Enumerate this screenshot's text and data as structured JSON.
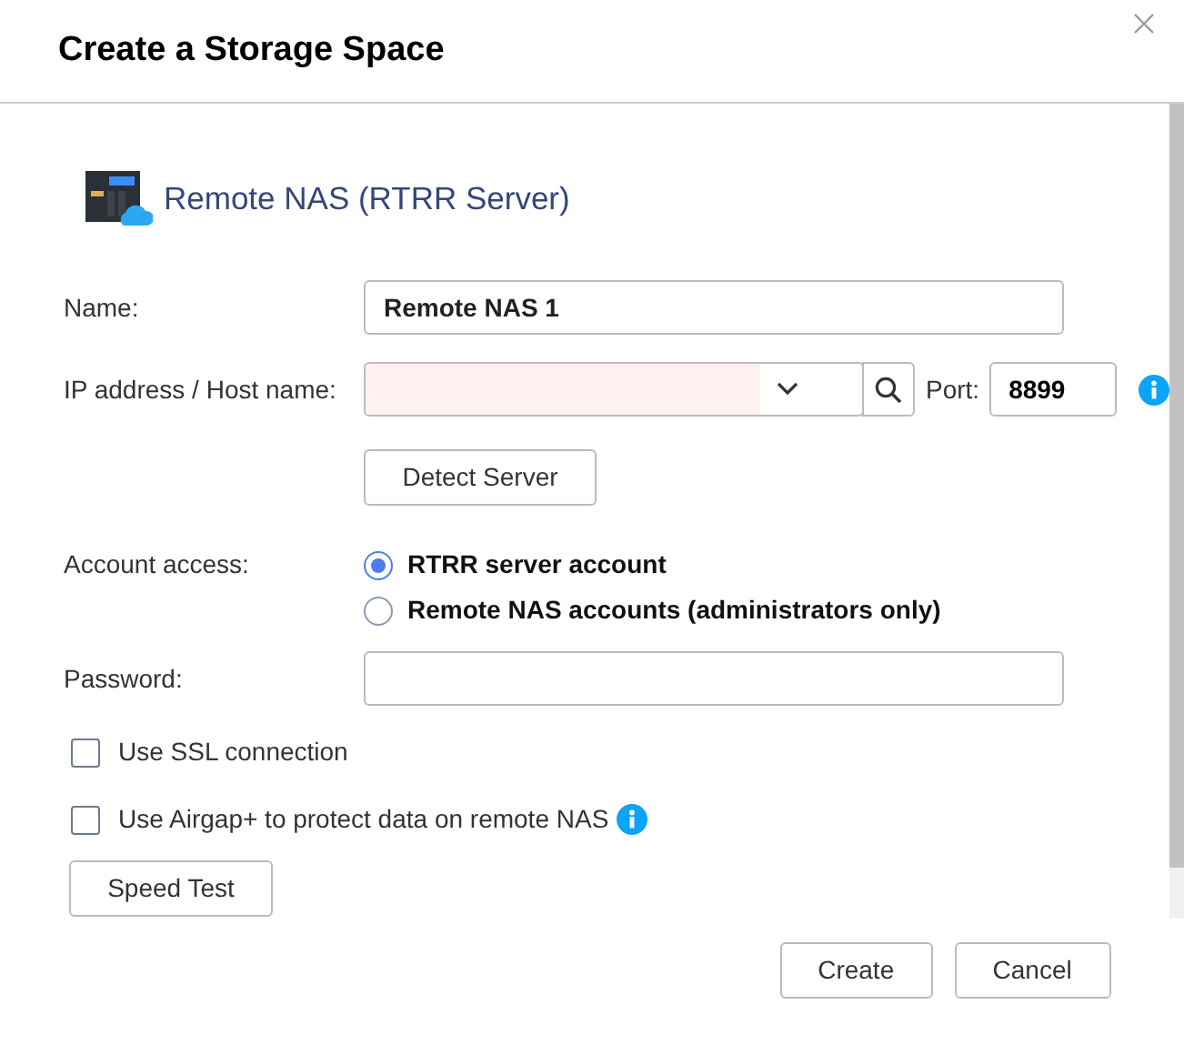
{
  "window": {
    "title": "Create a Storage Space"
  },
  "heading": "Remote NAS (RTRR Server)",
  "name_field": {
    "label": "Name:",
    "value": "Remote NAS 1"
  },
  "host_field": {
    "label": "IP address / Host name:",
    "invalid": true,
    "port_label": "Port:",
    "port_value": "8899"
  },
  "detect_button": "Detect Server",
  "account_access": {
    "label": "Account access:",
    "options": [
      {
        "label": "RTRR server account",
        "selected": true
      },
      {
        "label": "Remote NAS accounts (administrators only)",
        "selected": false
      }
    ]
  },
  "password_field": {
    "label": "Password:"
  },
  "options": [
    {
      "label": "Use SSL connection",
      "checked": false,
      "info": false
    },
    {
      "label": "Use Airgap+ to protect data on remote NAS",
      "checked": false,
      "info": true
    }
  ],
  "speed_test_button": "Speed Test",
  "buttons": [
    "Create",
    "Cancel"
  ]
}
